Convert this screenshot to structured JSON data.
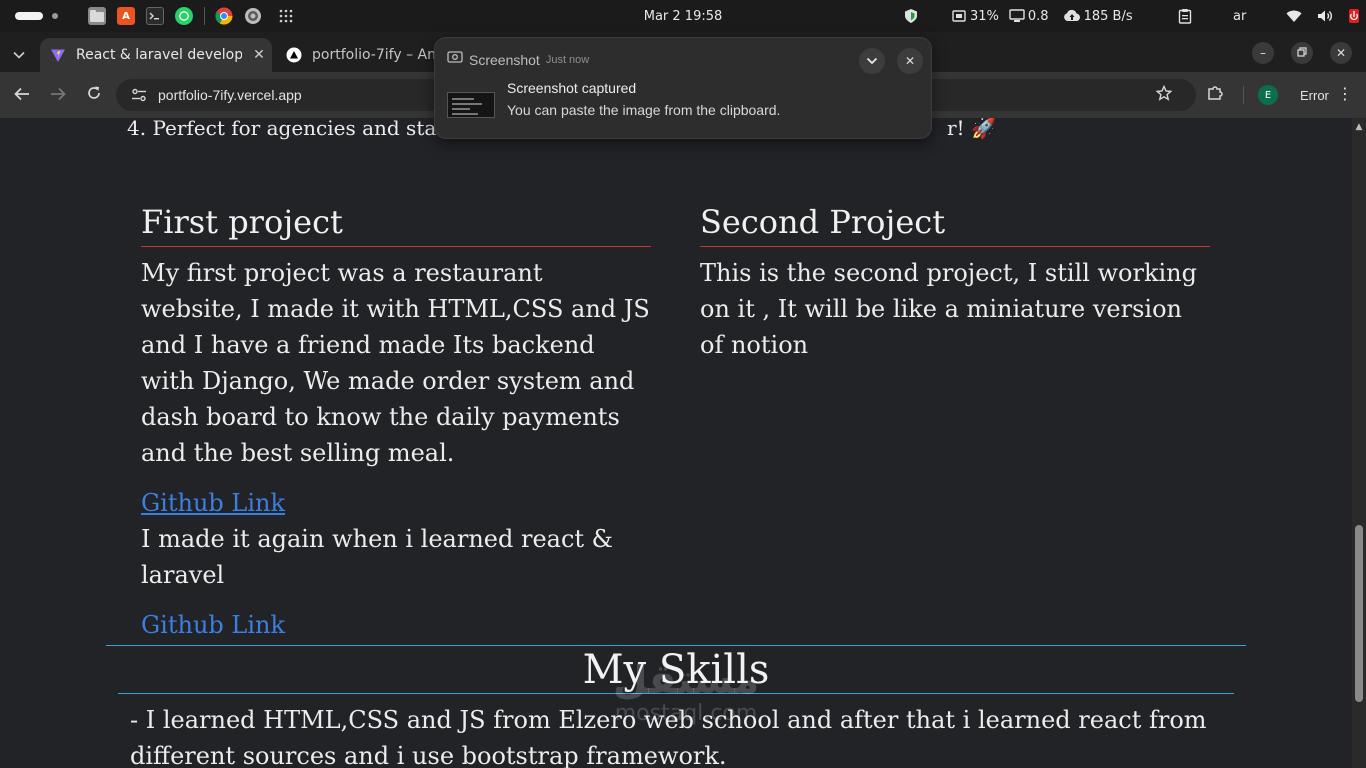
{
  "topbar": {
    "clock": "Mar 2  19:58",
    "cpu": "31%",
    "load": "0.8",
    "network": "185 B/s",
    "language": "ar"
  },
  "tabs": [
    {
      "title": "React & laravel develope",
      "active": true
    },
    {
      "title": "portfolio-7ify – An",
      "active": false
    }
  ],
  "toolbar": {
    "url": "portfolio-7ify.vercel.app",
    "profile_initial": "E",
    "error_label": "Error"
  },
  "notification": {
    "app": "Screenshot",
    "time": "Just now",
    "title": "Screenshot captured",
    "body": "You can paste the image from the clipboard."
  },
  "page": {
    "list_line_start": "4. Perfect for agencies and start",
    "list_line_end": "r! 🚀",
    "projects": [
      {
        "title": "First project",
        "description": "My first project was a restaurant website, I made it with HTML,CSS and JS and I have a friend made Its backend with Django, We made order system and dash board to know the daily payments and the best selling meal.",
        "link1": "Github Link",
        "again": "I made it again when i learned react & laravel",
        "link2": "Github Link"
      },
      {
        "title": "Second Project",
        "description": "This is the second project, I still working on it , It will be like a miniature version of notion"
      }
    ],
    "skills_title": "My Skills",
    "skills_text": "- I learned HTML,CSS and JS from Elzero web school and after that i learned react from different sources and i use bootstrap framework."
  },
  "watermark": {
    "arabic": "مستقل",
    "latin": "mostaql.com"
  },
  "colors": {
    "page_bg": "#222327",
    "project_rule": "#c0392b",
    "skills_rule": "#3aa3d6",
    "link": "#3d7fe0"
  }
}
